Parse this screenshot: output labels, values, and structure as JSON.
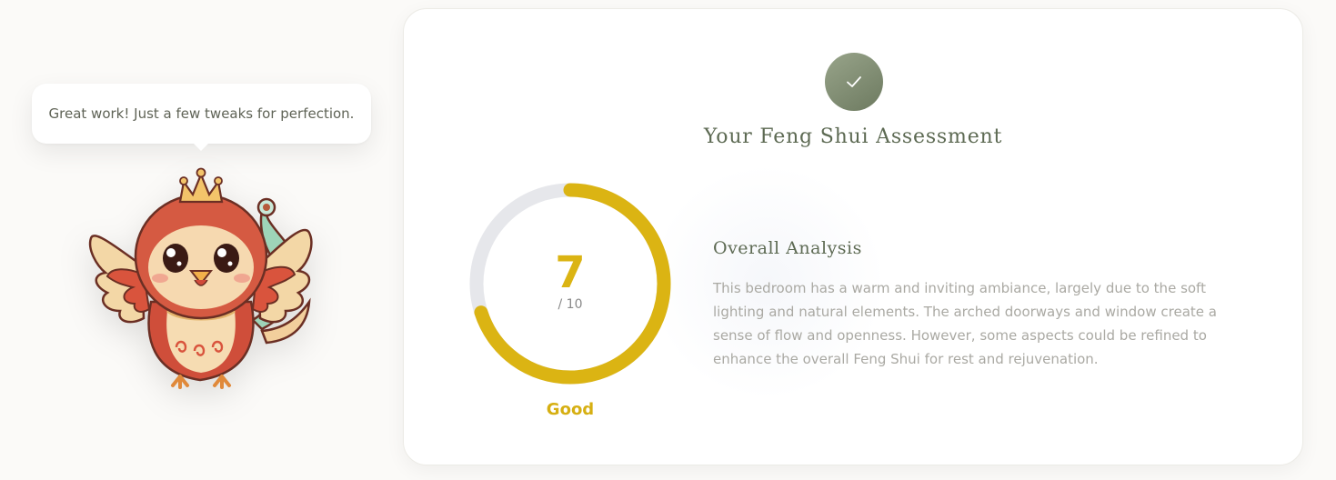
{
  "mascot": {
    "speech": "Great work! Just a few tweaks for perfection.",
    "icon": "phoenix-mascot"
  },
  "assessment": {
    "check_icon": "checkmark-icon",
    "title": "Your Feng Shui Assessment",
    "score": {
      "value": "7",
      "max": "/ 10",
      "fraction": 0.7,
      "rating": "Good"
    },
    "analysis": {
      "heading": "Overall Analysis",
      "text": "This bedroom has a warm and inviting ambiance, largely due to the soft lighting and natural elements. The arched doorways and window create a sense of flow and openness. However, some aspects could be refined to enhance the overall Feng Shui for rest and rejuvenation."
    }
  },
  "colors": {
    "accent": "#dbb413",
    "sage": "#5d6a53",
    "ring_track": "#e6e7eb"
  }
}
